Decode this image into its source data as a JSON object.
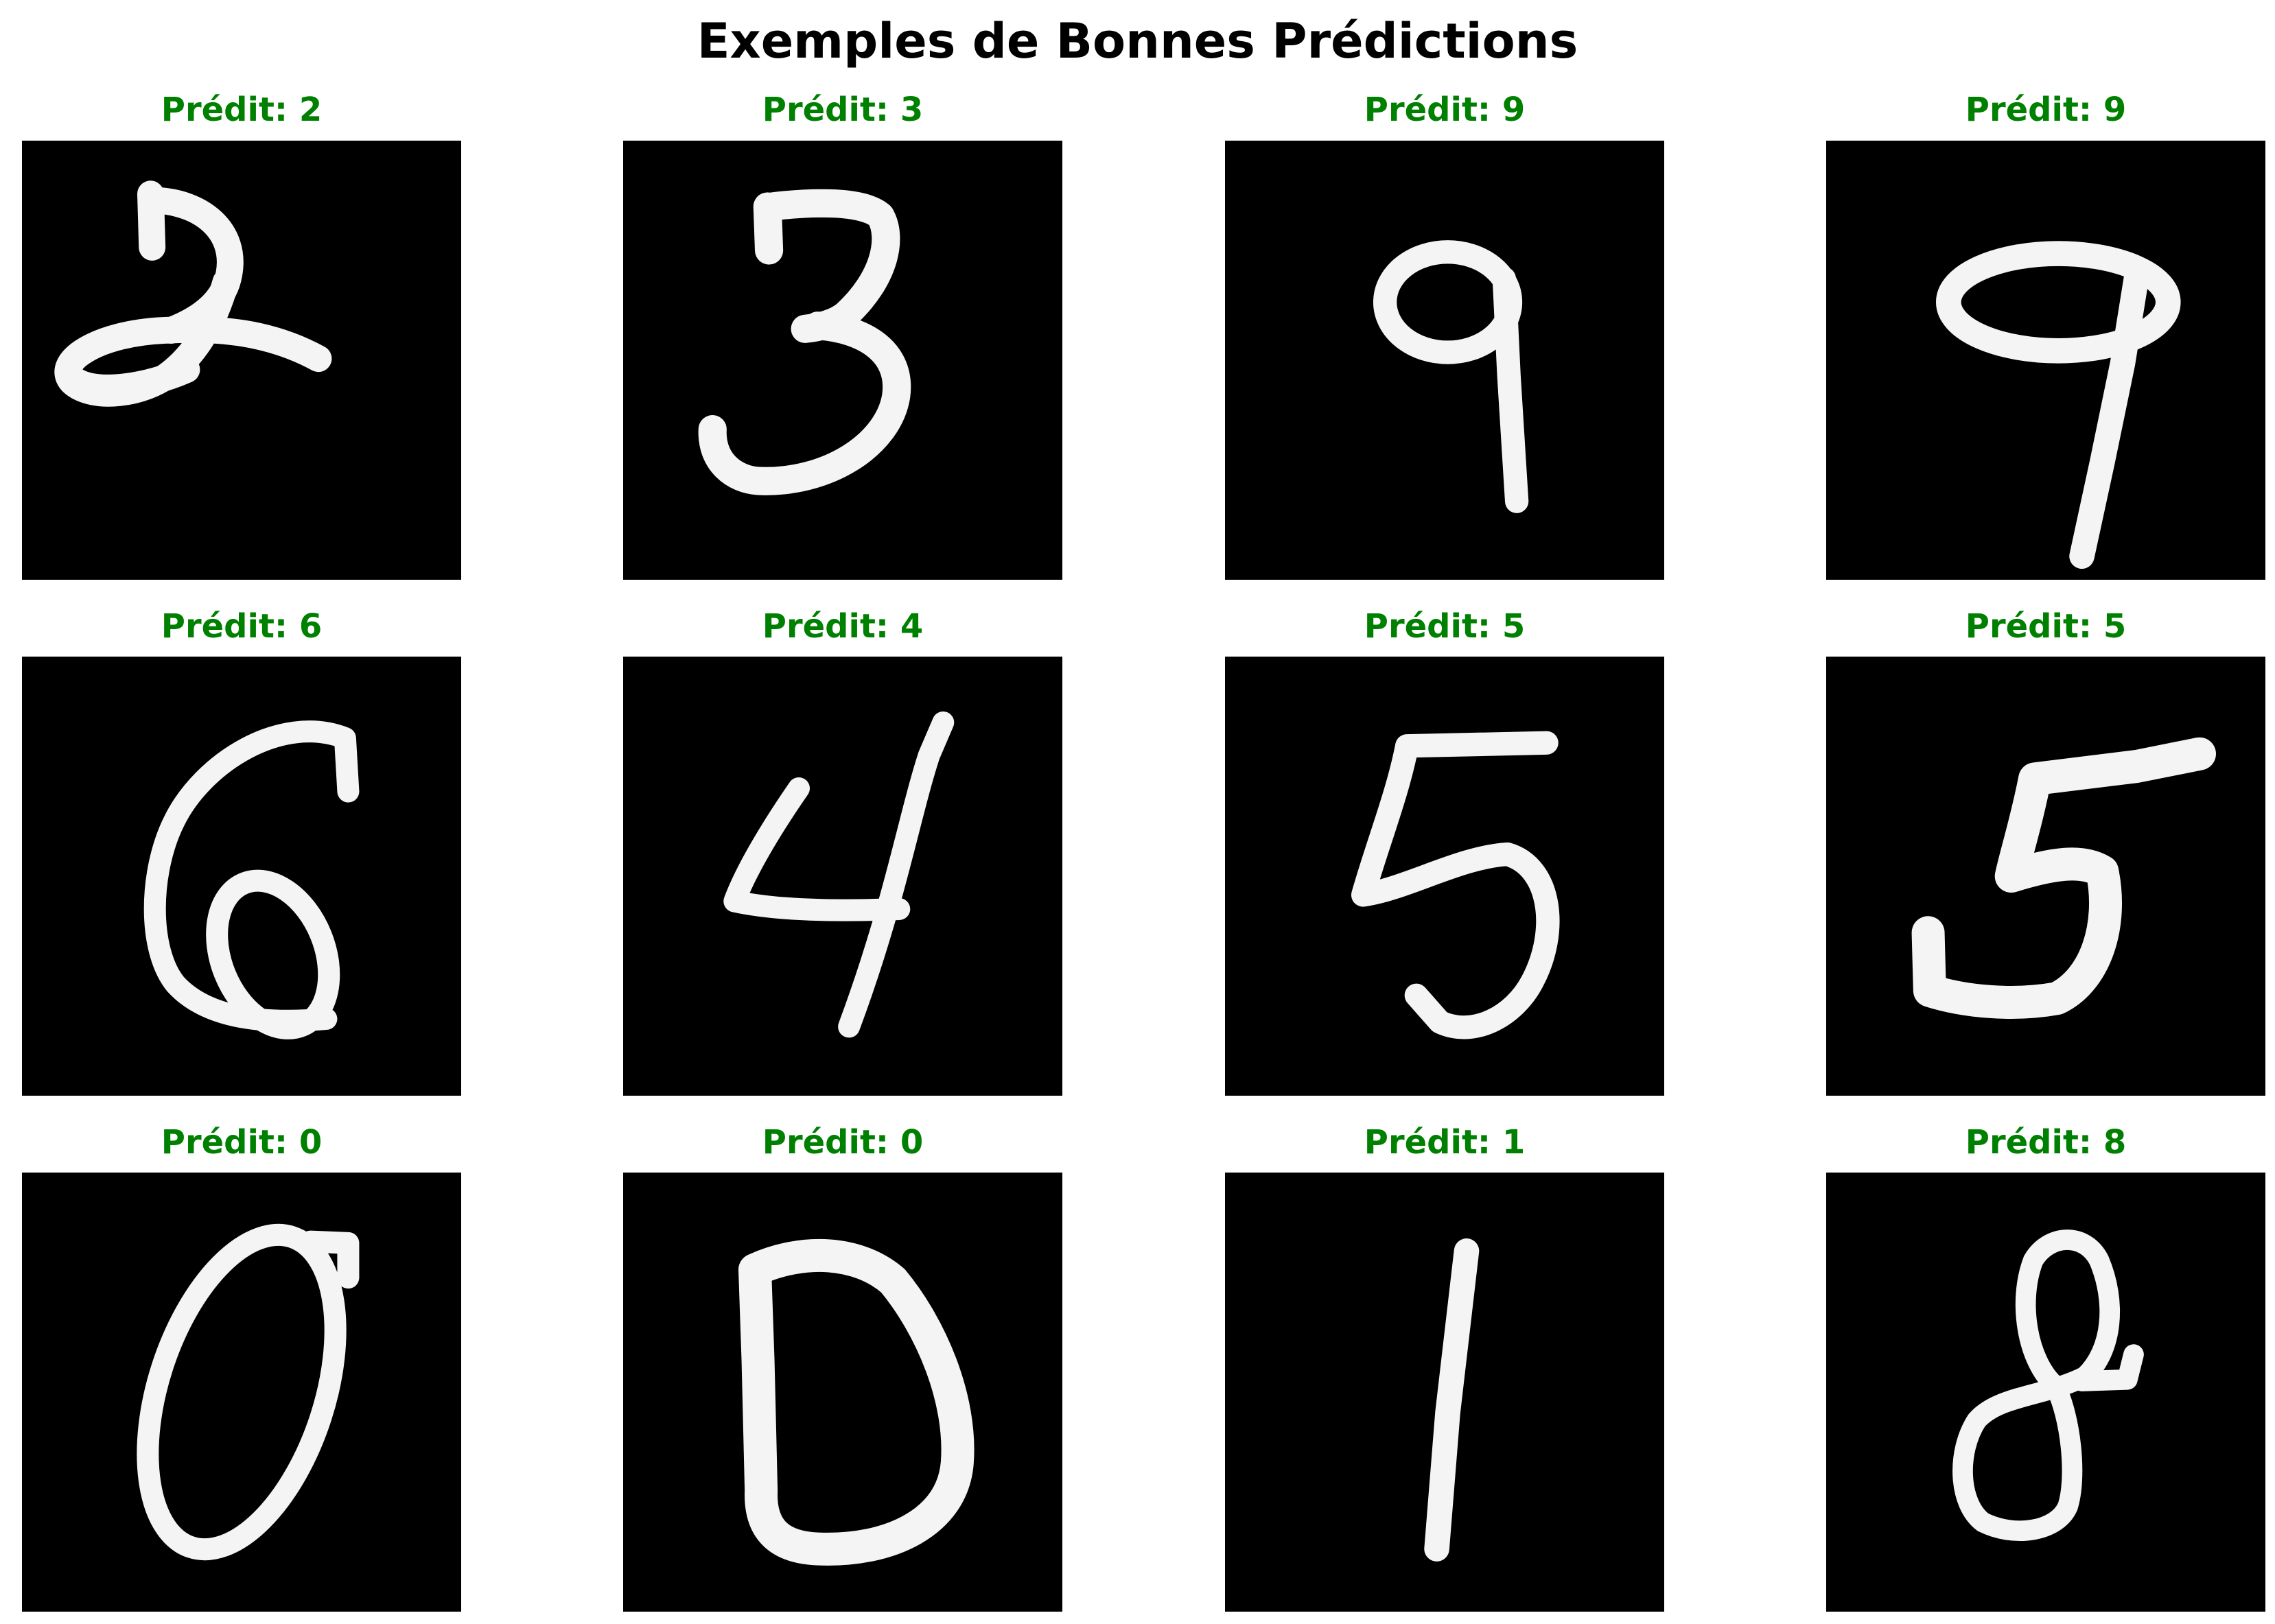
{
  "figure": {
    "title": "Exemples de Bonnes Prédictions",
    "label_color": "#008000",
    "panel_background": "#000000",
    "digit_color": "#ffffff"
  },
  "panels": [
    {
      "label": "Prédit: 2"
    },
    {
      "label": "Prédit: 3"
    },
    {
      "label": "Prédit: 9"
    },
    {
      "label": "Prédit: 9"
    },
    {
      "label": "Prédit: 6"
    },
    {
      "label": "Prédit: 4"
    },
    {
      "label": "Prédit: 5"
    },
    {
      "label": "Prédit: 5"
    },
    {
      "label": "Prédit: 0"
    },
    {
      "label": "Prédit: 0"
    },
    {
      "label": "Prédit: 1"
    },
    {
      "label": "Prédit: 8"
    }
  ]
}
